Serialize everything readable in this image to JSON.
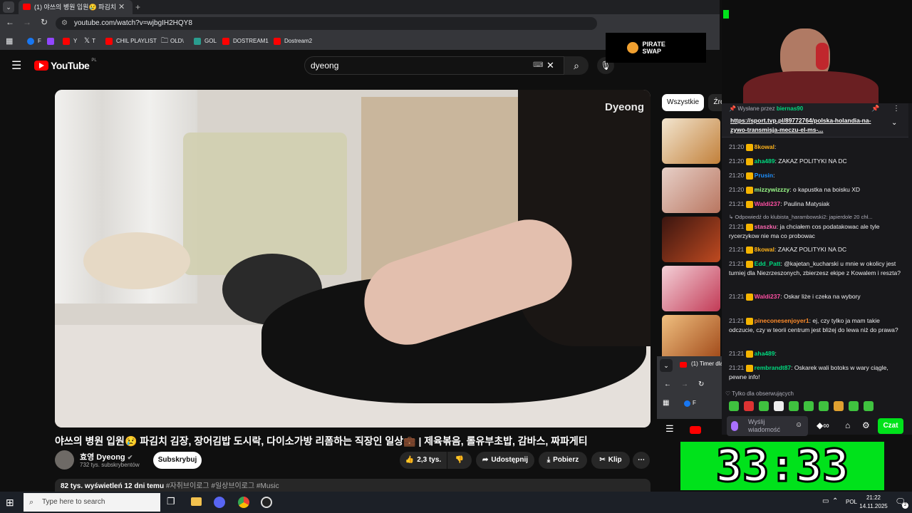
{
  "browser": {
    "tab_title": "(1) 야쓰의 병원 입원😢 파김치",
    "url": "youtube.com/watch?v=wjbgIH2HQY8",
    "bookmarks": [
      "F",
      "",
      "Y",
      "T",
      "CHIL PLAYLIST",
      "OLD\\",
      "GOL",
      "DOSTREAM1",
      "Dostream2"
    ]
  },
  "youtube": {
    "logo": "YouTube",
    "region": "PL",
    "search_value": "dyeong",
    "video_watermark": "Dyeong",
    "video_title": "야쓰의 병원 입원😢 파김치 김장, 장어김밥 도시락, 다이소가방 리폼하는 직장인 일상💼 | 제육볶음, 롤유부초밥, 감바스, 짜파게티",
    "channel_name": "효영 Dyeong",
    "subscribers": "732 tys. subskrybentów",
    "subscribe_label": "Subskrybuj",
    "likes": "2,3 tys.",
    "share_label": "Udostępnij",
    "download_label": "Pobierz",
    "clip_label": "Klip",
    "views_date": "82 tys. wyświetleń  12 dni temu",
    "hashtags": "#자취브이로그 #일상브이로그 #Music",
    "chips": [
      "Wszystkie",
      "Źró"
    ]
  },
  "overlay": {
    "sponsor": "PIRATE SWAP",
    "timer": "33:33",
    "timer_tab": "(1) Timer dla",
    "nested_bookmark": "F"
  },
  "chat": {
    "pinned_by_label": "Wysłane przez",
    "pinned_by_user": "biernas90",
    "pinned_link": "https://sport.tvp.pl/89772764/polska-holandia-na-zywo-transmisja-meczu-el-ms-...",
    "reply_context": "Odpowiedź do klubista_harambowski2: japierdole 20 chł...",
    "followers_only": "Tylko dla obserwujących",
    "input_placeholder": "Wyślij wiadomość",
    "send_label": "Czat",
    "messages": [
      {
        "time": "21:20",
        "user": "8kowal",
        "color": "#ffb31a",
        "text": ""
      },
      {
        "time": "21:20",
        "user": "aha489",
        "color": "#00d97e",
        "text": "ZAKAZ POLITYKI NA DC"
      },
      {
        "time": "21:20",
        "user": "Prusin",
        "color": "#1e90ff",
        "text": ""
      },
      {
        "time": "21:20",
        "user": "mizzywizzzy",
        "color": "#9dff8a",
        "text": "o kapustka na boisku XD"
      },
      {
        "time": "21:21",
        "user": "Waldi237",
        "color": "#ff4fa3",
        "text": "Paulina Matysiak"
      },
      {
        "time": "21:21",
        "user": "staszku",
        "color": "#ff69b4",
        "text": "ja chciałem cos podatakowac ale tyle rycerzykow nie ma co probowac"
      },
      {
        "time": "21:21",
        "user": "8kowal",
        "color": "#ffb31a",
        "text": "ZAKAZ POLITYKI NA DC"
      },
      {
        "time": "21:21",
        "user": "Edd_Patt",
        "color": "#00d97e",
        "text": "@kajetan_kucharski u mnie w okolicy jest turniej dla Niezrzeszonych, zbierzesz ekipe z Kowalem i reszta?"
      },
      {
        "time": "21:21",
        "user": "Waldi237",
        "color": "#ff4fa3",
        "text": "Oskar liże i czeka na wybory"
      },
      {
        "time": "21:21",
        "user": "pineconesenjoyer1",
        "color": "#ff8c2a",
        "text": "ej, czy tylko ja mam takie odczucie, czy w teorii centrum jest bliżej do lewa niż do prawa?"
      },
      {
        "time": "21:21",
        "user": "aha489",
        "color": "#00d97e",
        "text": ""
      },
      {
        "time": "21:21",
        "user": "rembrandt87",
        "color": "#00d97e",
        "text": "Oskarek wali botoks w wary ciągle, pewne info!"
      }
    ]
  },
  "taskbar": {
    "search_placeholder": "Type here to search",
    "language": "POL",
    "time": "21:22",
    "date": "14.11.2025",
    "notification_count": "2"
  }
}
